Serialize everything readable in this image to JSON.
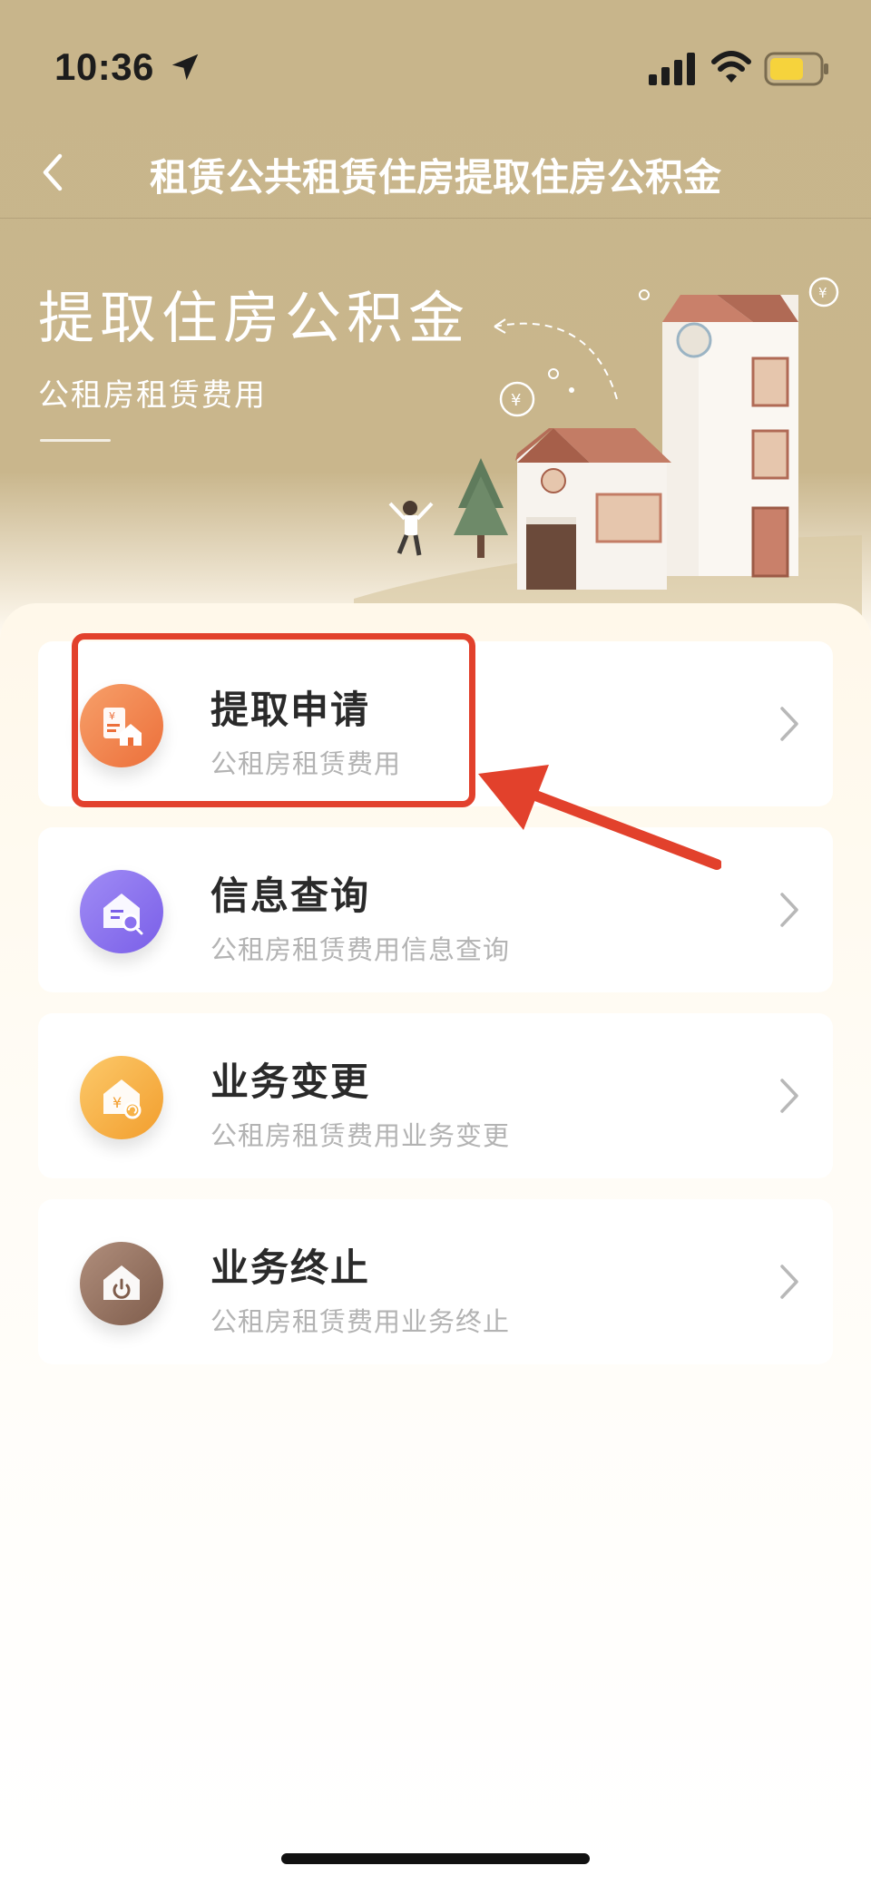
{
  "status_bar": {
    "time": "10:36",
    "icons": [
      "location-arrow-icon",
      "cellular-signal-icon",
      "wifi-icon",
      "battery-icon"
    ]
  },
  "nav": {
    "back_icon": "chevron-left-icon",
    "title": "租赁公共租赁住房提取住房公积金"
  },
  "banner": {
    "title": "提取住房公积金",
    "subtitle": "公租房租赁费用"
  },
  "menu": {
    "items": [
      {
        "title": "提取申请",
        "subtitle": "公租房租赁费用",
        "icon": "document-house-icon",
        "color": "#f0844a"
      },
      {
        "title": "信息查询",
        "subtitle": "公租房租赁费用信息查询",
        "icon": "house-search-icon",
        "color": "#8b72ef"
      },
      {
        "title": "业务变更",
        "subtitle": "公租房租赁费用业务变更",
        "icon": "house-yen-refresh-icon",
        "color": "#f7b247"
      },
      {
        "title": "业务终止",
        "subtitle": "公租房租赁费用业务终止",
        "icon": "house-power-icon",
        "color": "#9a7563"
      }
    ]
  },
  "colors": {
    "header_bg": "#c8b58b",
    "annotation_red": "#e2412c"
  }
}
